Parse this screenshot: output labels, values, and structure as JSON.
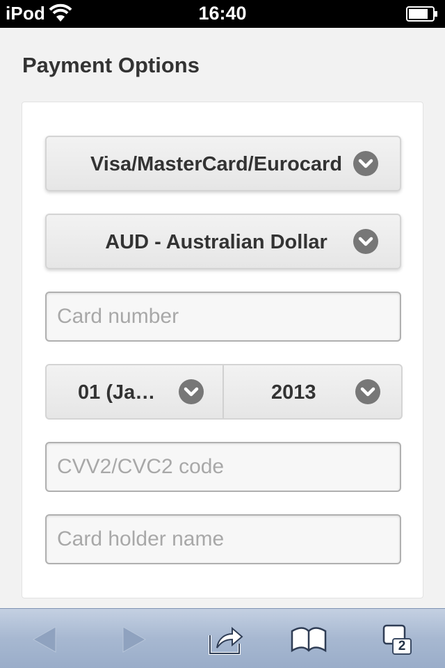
{
  "status_bar": {
    "carrier": "iPod",
    "time": "16:40",
    "icons": [
      "wifi-icon",
      "battery-icon"
    ]
  },
  "page": {
    "title": "Payment Options"
  },
  "form": {
    "card_type": {
      "value": "Visa/MasterCard/Eurocard",
      "icon": "chevron-down-icon"
    },
    "currency": {
      "value": "AUD - Australian Dollar",
      "icon": "chevron-down-icon"
    },
    "card_number": {
      "placeholder": "Card number",
      "value": ""
    },
    "expiry_month": {
      "value": "01 (Ja…",
      "icon": "chevron-down-icon"
    },
    "expiry_year": {
      "value": "2013",
      "icon": "chevron-down-icon"
    },
    "cvv": {
      "placeholder": "CVV2/CVC2 code",
      "value": ""
    },
    "holder_name": {
      "placeholder": "Card holder name",
      "value": ""
    }
  },
  "toolbar": {
    "buttons": [
      "back-icon",
      "forward-icon",
      "share-icon",
      "bookmarks-icon",
      "tabs-icon"
    ],
    "tabs_count": "2"
  },
  "colors": {
    "status_bar_bg": "#000000",
    "page_bg": "#f2f2f2",
    "card_bg": "#ffffff",
    "text": "#333333",
    "placeholder": "#a8a8a8",
    "chevron_bg": "#777777",
    "toolbar_bg": "#a7b8d1"
  }
}
